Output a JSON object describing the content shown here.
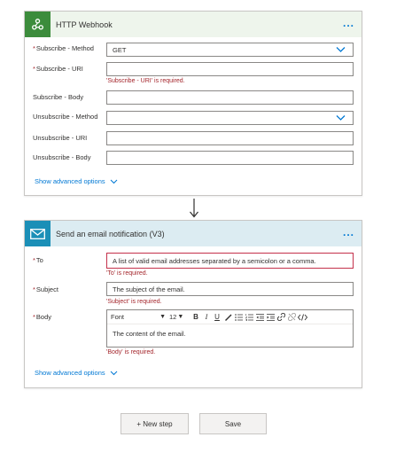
{
  "webhook": {
    "title": "HTTP Webhook",
    "more": "...",
    "icon": "webhook-icon",
    "accent": "#3c8c3c",
    "fields": [
      {
        "label": "Subscribe - Method",
        "required": true,
        "value": "GET",
        "type": "select"
      },
      {
        "label": "Subscribe - URI",
        "required": true,
        "value": "",
        "type": "text",
        "error": "'Subscribe - URI' is required."
      },
      {
        "label": "Subscribe - Body",
        "required": false,
        "value": "",
        "type": "text"
      },
      {
        "label": "Unsubscribe - Method",
        "required": false,
        "value": "",
        "type": "select"
      },
      {
        "label": "Unsubscribe - URI",
        "required": false,
        "value": "",
        "type": "text"
      },
      {
        "label": "Unsubscribe - Body",
        "required": false,
        "value": "",
        "type": "text"
      }
    ],
    "advanced": "Show advanced options"
  },
  "email": {
    "title": "Send an email notification (V3)",
    "more": "...",
    "icon": "mail-icon",
    "accent": "#1b8fb7",
    "to": {
      "label": "To",
      "placeholder": "A list of valid email addresses separated by a semicolon or a comma.",
      "error": "'To' is required."
    },
    "subject": {
      "label": "Subject",
      "placeholder": "The subject of the email.",
      "error": "'Subject' is required."
    },
    "body": {
      "label": "Body",
      "font": "Font",
      "size": "12",
      "placeholder": "The content of the email.",
      "error": "'Body' is required."
    },
    "advanced": "Show advanced options"
  },
  "footer": {
    "new_step": "+ New step",
    "save": "Save"
  },
  "required_mark": "*"
}
